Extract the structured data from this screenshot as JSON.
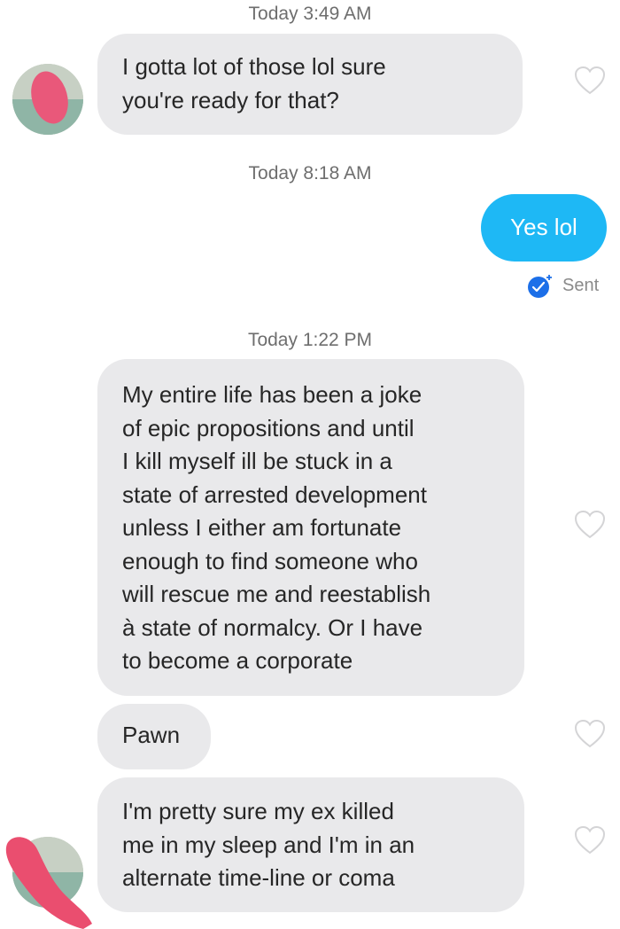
{
  "timestamps": [
    "Today 3:49 AM",
    "Today 8:18 AM",
    "Today 1:22 PM"
  ],
  "messages": {
    "m1": "I gotta lot of those lol sure\nyou're ready for that?",
    "m2": "Yes lol",
    "m3": "My entire life has been a joke\nof epic propositions and until\nI kill myself ill be stuck in a\nstate of arrested development\nunless I either am fortunate\nenough to find someone who\nwill rescue me and reestablish\nà state of normalcy. Or I have\nto become a corporate",
    "m4": "Pawn",
    "m5": "I'm pretty sure my ex killed\nme in my sleep and I'm in an\nalternate time-line or coma"
  },
  "status": {
    "sent": "Sent"
  },
  "icons": {
    "like": "heart-outline-icon",
    "delivered": "check-badge-icon",
    "avatar": "avatar"
  },
  "colors": {
    "incoming_bubble": "#e9e9eb",
    "outgoing_bubble": "#1eb8f5",
    "check_badge": "#1c6fe8",
    "redaction": "#ea4e6f"
  }
}
